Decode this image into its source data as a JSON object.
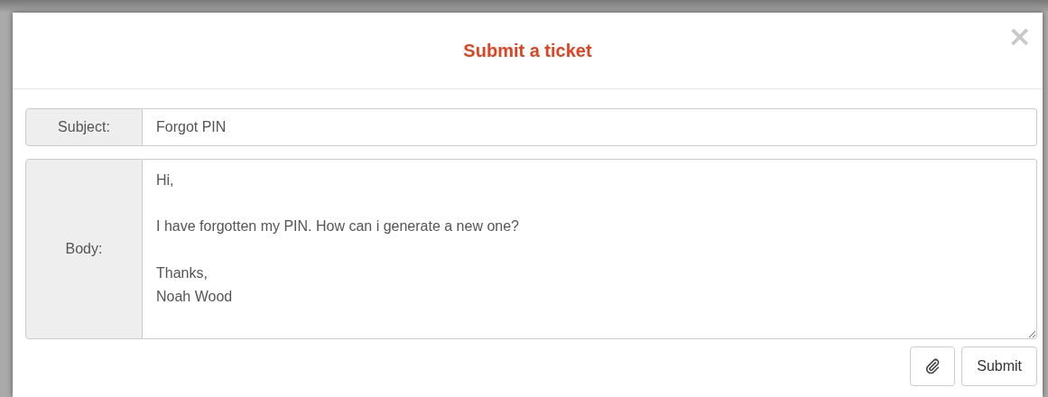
{
  "dialog": {
    "title": "Submit a ticket",
    "close": "×"
  },
  "fields": [
    {
      "label": "Subject:",
      "kind": "input",
      "value": "Forgot PIN"
    },
    {
      "label": "Body:",
      "kind": "textarea",
      "value": "Hi,\n\nI have forgotten my PIN. How can i generate a new one?\n\nThanks,\nNoah Wood"
    }
  ],
  "buttons": [
    {
      "kind": "attach"
    },
    {
      "kind": "text",
      "label": "Submit"
    }
  ]
}
